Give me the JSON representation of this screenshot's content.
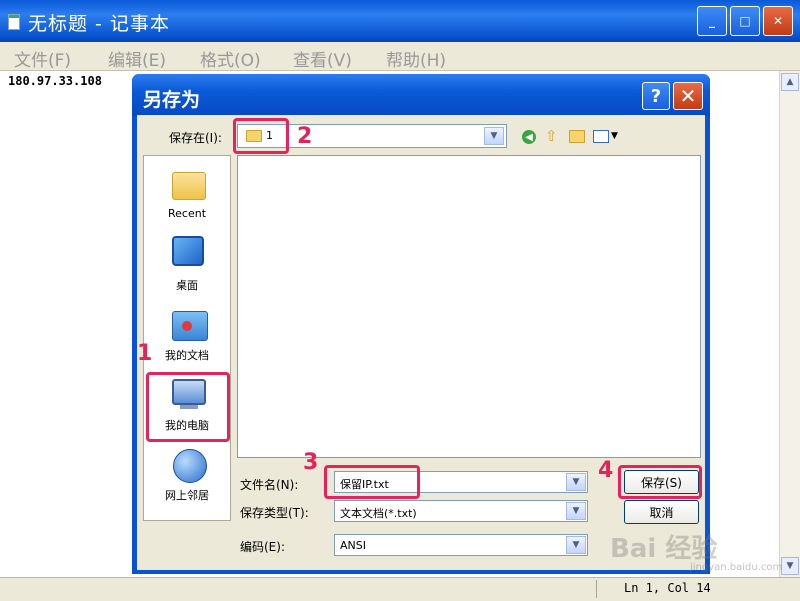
{
  "notepad": {
    "title": "无标题 - 记事本",
    "controls": {
      "minimize": "_",
      "maximize": "□",
      "close": "✕"
    },
    "menu": [
      "文件(F)",
      "编辑(E)",
      "格式(O)",
      "查看(V)",
      "帮助(H)"
    ],
    "content": "180.97.33.108",
    "status": "Ln 1, Col 14"
  },
  "dialog": {
    "title": "另存为",
    "help_label": "?",
    "close_label": "✕",
    "save_in_label": "保存在(I):",
    "save_in_value": "1",
    "places": [
      {
        "label": "Recent",
        "icon": "recent-folder-icon"
      },
      {
        "label": "桌面",
        "icon": "desktop-icon"
      },
      {
        "label": "我的文档",
        "icon": "my-documents-icon"
      },
      {
        "label": "我的电脑",
        "icon": "my-computer-icon"
      },
      {
        "label": "网上邻居",
        "icon": "network-places-icon"
      }
    ],
    "filename_label": "文件名(N):",
    "filename_value": "保留IP.txt",
    "filetype_label": "保存类型(T):",
    "filetype_value": "文本文档(*.txt)",
    "encoding_label": "编码(E):",
    "encoding_value": "ANSI",
    "save_button": "保存(S)",
    "cancel_button": "取消"
  },
  "annotations": [
    "1",
    "2",
    "3",
    "4"
  ],
  "watermark": {
    "text": "Bai 经验",
    "sub": "jingyan.baidu.com"
  },
  "colors": {
    "titlebar": "#0a5ad8",
    "highlight": "#e5245e",
    "dialog_bg": "#ece9d8"
  }
}
